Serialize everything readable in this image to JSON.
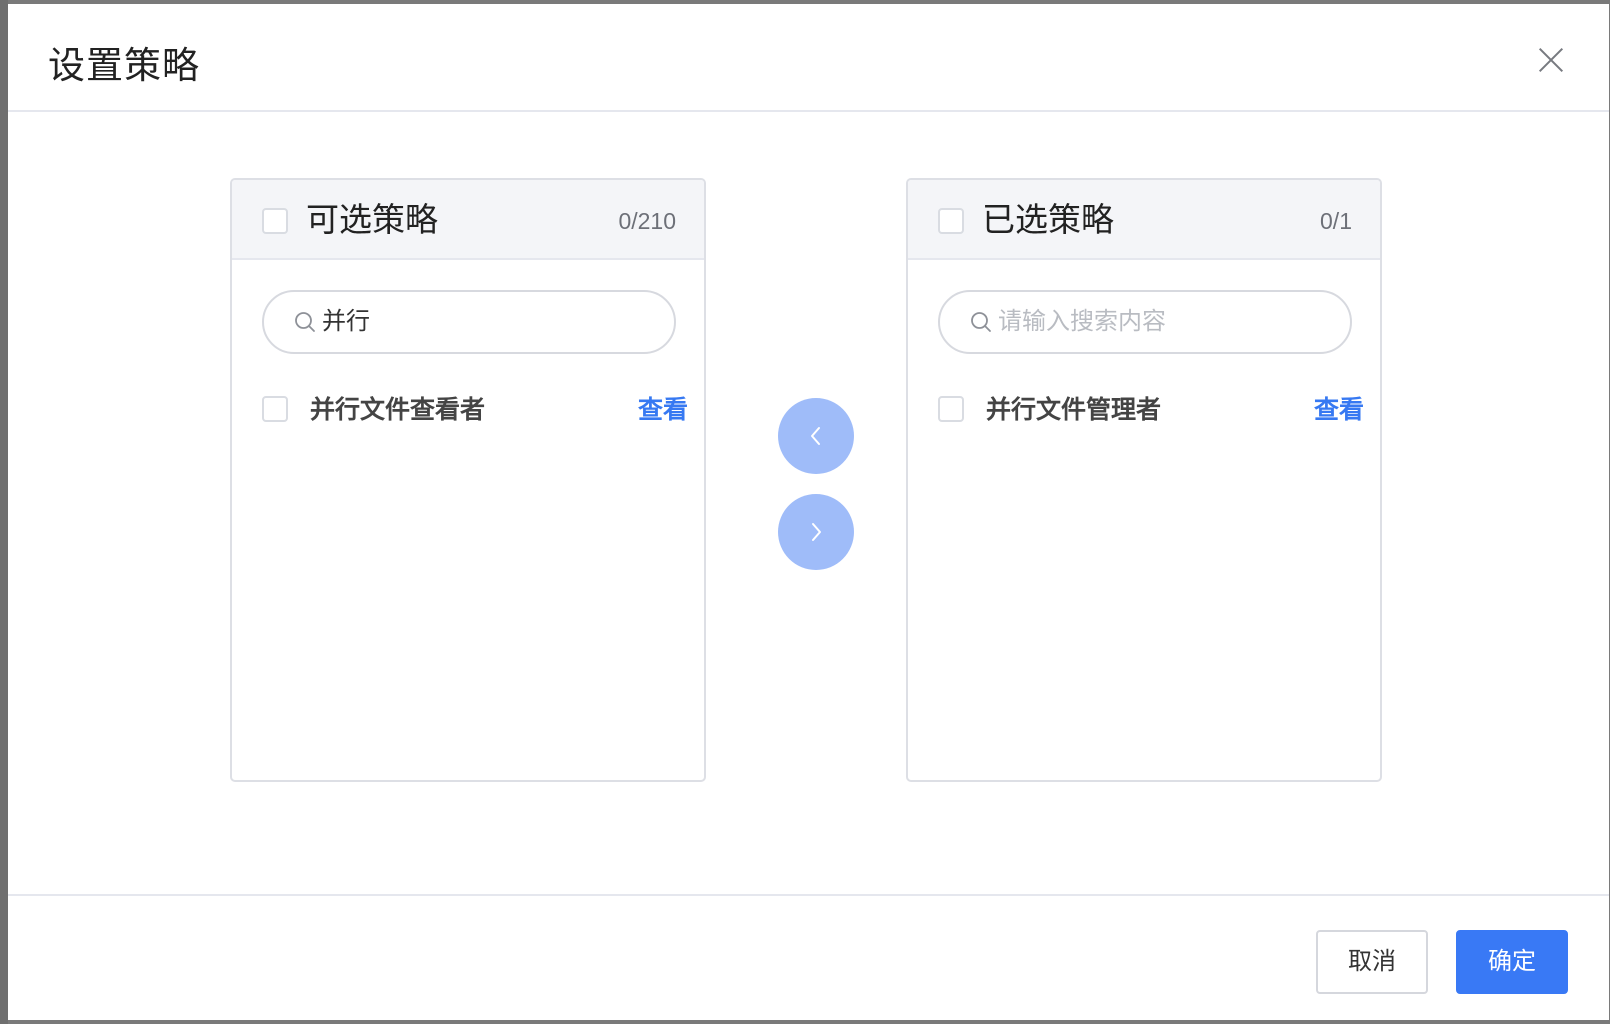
{
  "dialog": {
    "title": "设置策略"
  },
  "available": {
    "title": "可选策略",
    "count": "0/210",
    "search": {
      "value": "并行",
      "placeholder": "请输入搜索内容"
    },
    "items": [
      {
        "label": "并行文件查看者",
        "action": "查看"
      }
    ]
  },
  "selected": {
    "title": "已选策略",
    "count": "0/1",
    "search": {
      "value": "",
      "placeholder": "请输入搜索内容"
    },
    "items": [
      {
        "label": "并行文件管理者",
        "action": "查看"
      }
    ]
  },
  "footer": {
    "cancel_label": "取消",
    "confirm_label": "确定"
  },
  "colors": {
    "primary": "#3979F5",
    "transfer_button": "#9FBCF9",
    "link": "#3779F2"
  },
  "icons": {
    "close": "close-icon",
    "search": "search-icon",
    "move_left": "chevron-left-icon",
    "move_right": "chevron-right-icon"
  }
}
